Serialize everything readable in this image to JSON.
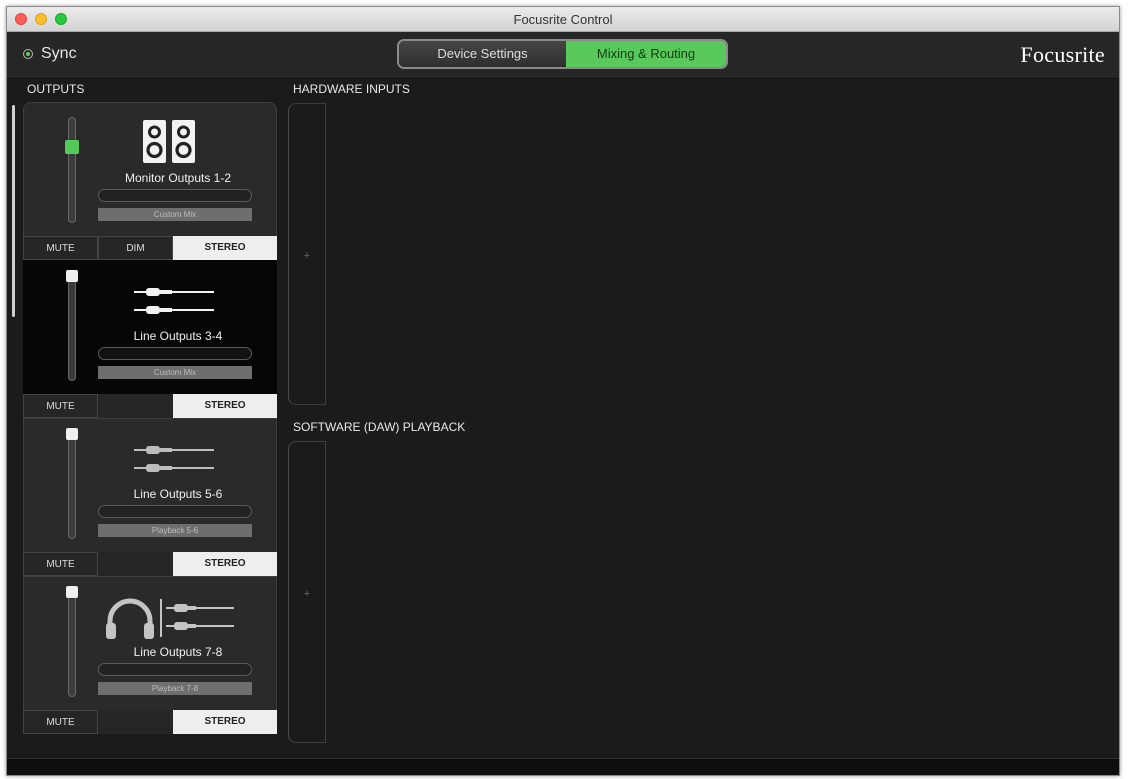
{
  "window": {
    "title": "Focusrite Control"
  },
  "toolbar": {
    "sync_label": "Sync",
    "tabs": [
      {
        "label": "Device Settings",
        "active": false
      },
      {
        "label": "Mixing & Routing",
        "active": true
      }
    ],
    "logo": "Focusrite"
  },
  "sections": {
    "outputs": "OUTPUTS",
    "hardware_inputs": "HARDWARE INPUTS",
    "software_playback": "SOFTWARE (DAW) PLAYBACK"
  },
  "outputs": [
    {
      "name": "Monitor Outputs 1-2",
      "source": "Custom Mix",
      "icon": "monitor-speakers-icon",
      "mute": "MUTE",
      "dim": "DIM",
      "stereo": "STEREO"
    },
    {
      "name": "Line Outputs 3-4",
      "source": "Custom Mix",
      "icon": "jack-cables-icon",
      "mute": "MUTE",
      "stereo": "STEREO"
    },
    {
      "name": "Line Outputs 5-6",
      "source": "Playback 5-6",
      "icon": "jack-cables-icon",
      "mute": "MUTE",
      "stereo": "STEREO"
    },
    {
      "name": "Line Outputs 7-8",
      "source": "Playback 7-8",
      "icon": "headphones-jack-icon",
      "mute": "MUTE",
      "stereo": "STEREO"
    }
  ],
  "strips": {
    "plus_symbol": "+"
  },
  "colors": {
    "accent": "#58c95a",
    "background": "#1b1b1b"
  }
}
